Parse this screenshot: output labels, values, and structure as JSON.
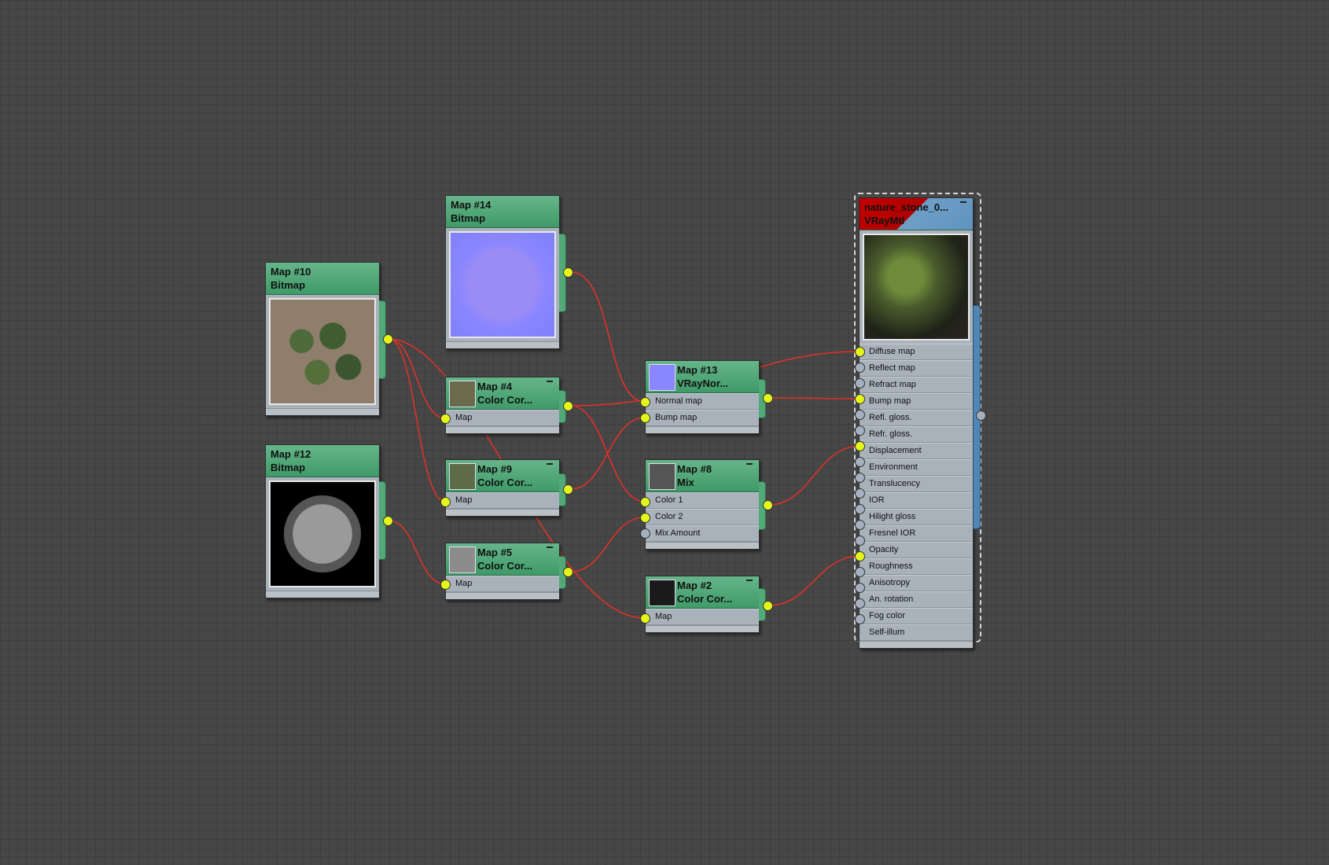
{
  "nodes": {
    "map10": {
      "title": "Map #10",
      "type": "Bitmap"
    },
    "map12": {
      "title": "Map #12",
      "type": "Bitmap"
    },
    "map14": {
      "title": "Map #14",
      "type": "Bitmap"
    },
    "map4": {
      "title": "Map #4",
      "type": "Color Cor...",
      "slots": [
        "Map"
      ]
    },
    "map9": {
      "title": "Map #9",
      "type": "Color Cor...",
      "slots": [
        "Map"
      ]
    },
    "map5": {
      "title": "Map #5",
      "type": "Color Cor...",
      "slots": [
        "Map"
      ]
    },
    "map13": {
      "title": "Map #13",
      "type": "VRayNor...",
      "slots": [
        "Normal map",
        "Bump map"
      ]
    },
    "map8": {
      "title": "Map #8",
      "type": "Mix",
      "slots": [
        "Color 1",
        "Color 2",
        "Mix Amount"
      ]
    },
    "map2": {
      "title": "Map #2",
      "type": "Color Cor...",
      "slots": [
        "Map"
      ]
    },
    "material": {
      "title": "nature_stone_0...",
      "type": "VRayMtl",
      "slots": [
        "Diffuse map",
        "Reflect map",
        "Refract map",
        "Bump map",
        "Refl. gloss.",
        "Refr. gloss.",
        "Displacement",
        "Environment",
        "Translucency",
        "IOR",
        "Hilight gloss",
        "Fresnel IOR",
        "Opacity",
        "Roughness",
        "Anisotropy",
        "An. rotation",
        "Fog color",
        "Self-illum"
      ]
    }
  },
  "colors": {
    "wire": "#e0302a",
    "port_on": "#e4f51a",
    "port_off": "#a4b0c0",
    "node_header": "#4fa574",
    "canvas": "#474747"
  }
}
